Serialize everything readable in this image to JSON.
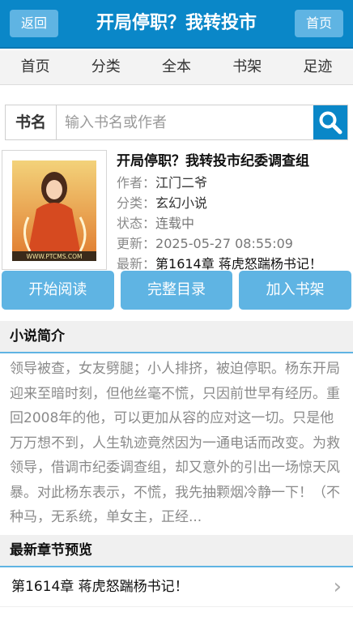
{
  "header": {
    "back_label": "返回",
    "title": "开局停职？我转投市",
    "home_label": "首页"
  },
  "nav": [
    "首页",
    "分类",
    "全本",
    "书架",
    "足迹"
  ],
  "search": {
    "label": "书名",
    "placeholder": "输入书名或作者",
    "icon": "search-icon"
  },
  "book": {
    "cover_text": "WWW.PTCMS.COM",
    "title": "开局停职？我转投市纪委调查组",
    "fields": [
      {
        "key": "作者：",
        "value": "江门二爷"
      },
      {
        "key": "分类：",
        "value": "玄幻小说"
      },
      {
        "key": "状态：",
        "value": "连载中"
      },
      {
        "key": "更新：",
        "value": "2025-05-27 08:55:09"
      },
      {
        "key": "最新：",
        "value": "第1614章 蒋虎怒踹杨书记！"
      }
    ]
  },
  "actions": [
    "开始阅读",
    "完整目录",
    "加入书架"
  ],
  "intro": {
    "heading": "小说简介",
    "text": "领导被查，女友劈腿；小人排挤，被迫停职。杨东开局迎来至暗时刻，但他丝毫不慌，只因前世早有经历。重回2008年的他，可以更加从容的应对这一切。只是他万万想不到，人生轨迹竟然因为一通电话而改变。为救领导，借调市纪委调查组，却又意外的引出一场惊天风暴。对此杨东表示，不慌，我先抽颗烟冷静一下！（不种马，无系统，单女主，正经..."
  },
  "latest": {
    "heading": "最新章节预览",
    "chapter": "第1614章 蒋虎怒踹杨书记！",
    "arrow_icon": "chevron-right-icon"
  },
  "colors": {
    "primary": "#0a87c8",
    "button": "#5fb4e3"
  }
}
